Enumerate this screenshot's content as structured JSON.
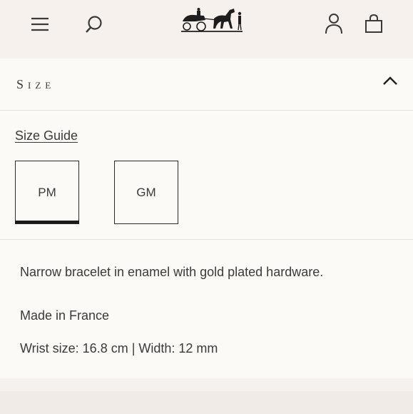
{
  "header": {
    "menu_icon": "hamburger-icon",
    "search_icon": "search-icon",
    "logo": "horse-carriage-logo",
    "account_icon": "person-icon",
    "cart_icon": "shopping-bag-icon"
  },
  "size_section": {
    "title": "Size",
    "toggle_icon": "chevron-up-icon",
    "size_guide_label": "Size Guide",
    "options": [
      {
        "label": "PM",
        "selected": true
      },
      {
        "label": "GM",
        "selected": false
      }
    ]
  },
  "details": {
    "description": "Narrow bracelet in enamel with gold plated hardware.",
    "origin": "Made in France",
    "dimensions": "Wrist size: 16.8 cm | Width: 12 mm"
  },
  "colors": {
    "background": "#f6f1ec",
    "panel": "#fcfaf7",
    "text": "#3a3a3a",
    "border": "#2b2b2b"
  }
}
